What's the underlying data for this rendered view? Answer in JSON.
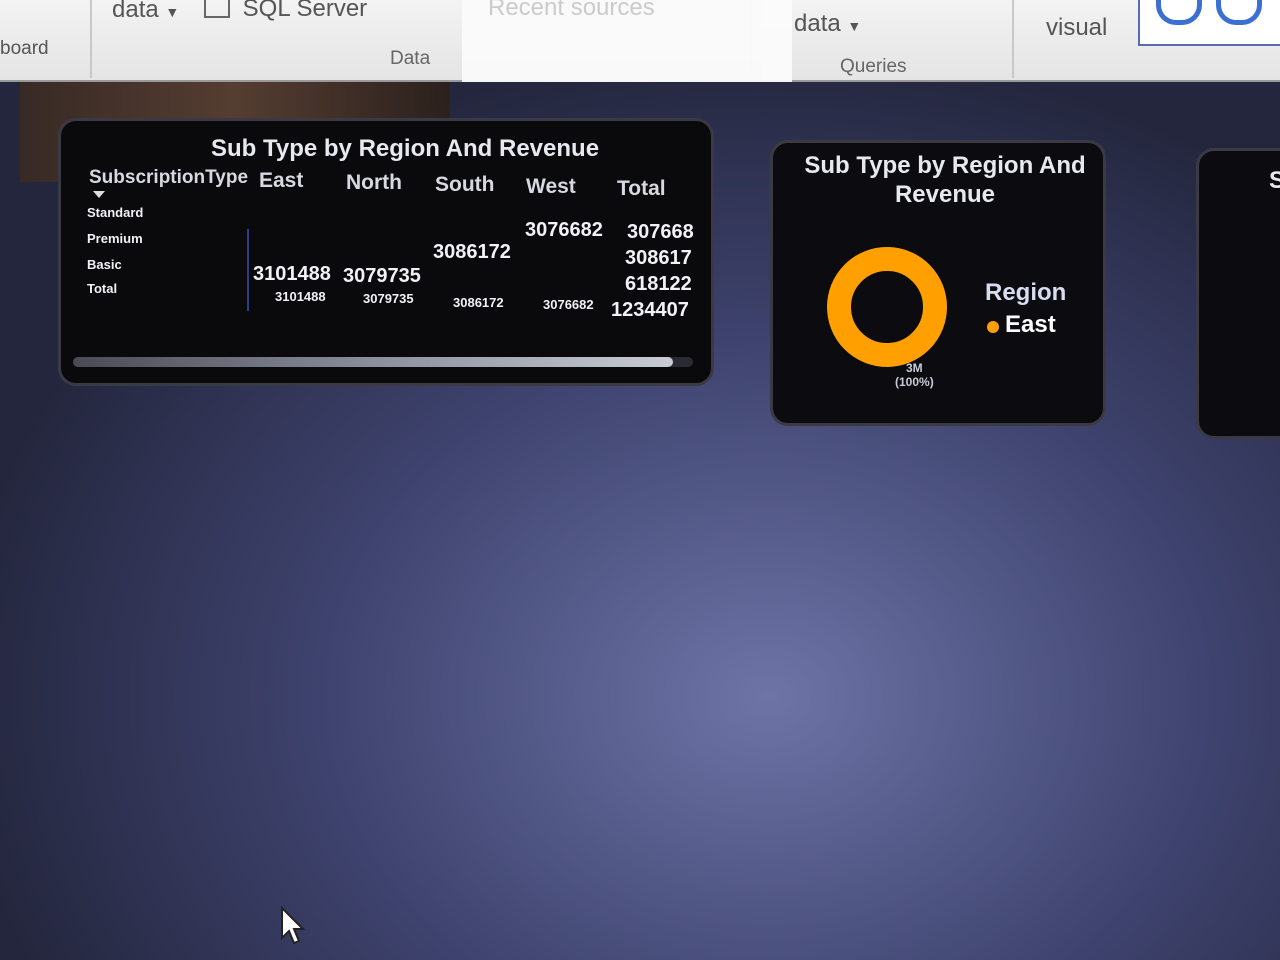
{
  "ribbon": {
    "board_label": "board",
    "get_data_label": "data",
    "sql_server_label": "SQL Server",
    "recent_sources_label": "Recent sources",
    "data_group_label": "Data",
    "transform_data_label": "data",
    "queries_group_label": "Queries",
    "new_visual_label": "visual"
  },
  "table_visual": {
    "title": "Sub Type by Region And Revenue",
    "headers": [
      "SubscriptionType",
      "East",
      "North",
      "South",
      "West",
      "Total"
    ],
    "rows": [
      {
        "label": "Standard",
        "east": "",
        "north": "",
        "south": "",
        "west": "3076682",
        "total": "307668"
      },
      {
        "label": "Premium",
        "east": "",
        "north": "",
        "south": "3086172",
        "west": "",
        "total": "308617"
      },
      {
        "label": "Basic",
        "east": "3101488",
        "north": "3079735",
        "south": "",
        "west": "",
        "total": "618122"
      },
      {
        "label": "Total",
        "east": "3101488",
        "north": "3079735",
        "south": "3086172",
        "west": "3076682",
        "total": "1234407"
      }
    ]
  },
  "donut_visual": {
    "title": "Sub Type by Region And Revenue",
    "legend_title": "Region",
    "legend_items": [
      {
        "name": "East",
        "color": "#ffa000"
      }
    ],
    "slice_label": "3M",
    "slice_percent": "(100%)",
    "chart_data": {
      "type": "pie",
      "categories": [
        "East"
      ],
      "values": [
        100
      ]
    }
  },
  "partial_visual": {
    "title_fragment": "S"
  },
  "colors": {
    "accent_orange": "#ffa000",
    "visual_bg": "#0a0a0c"
  }
}
